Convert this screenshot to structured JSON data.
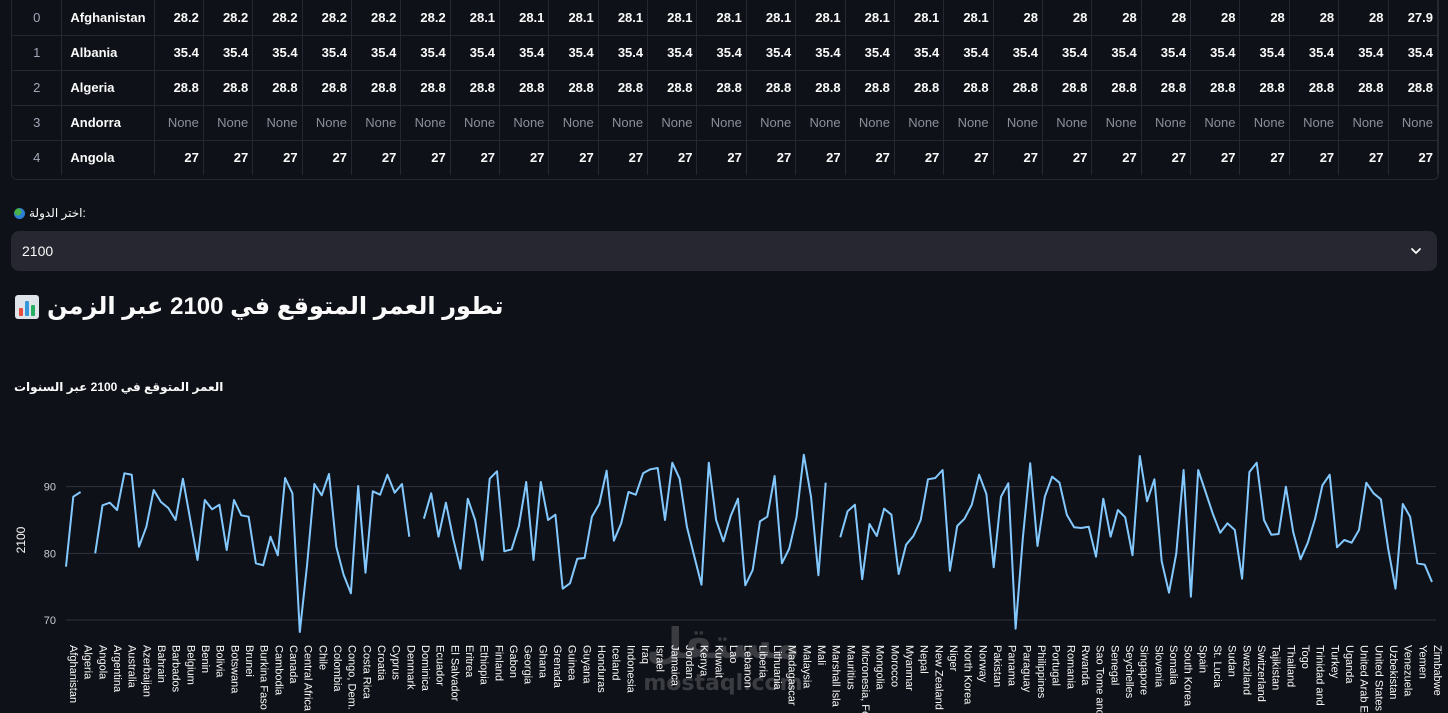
{
  "table": {
    "rows": [
      {
        "index": "0",
        "country": "Afghanistan",
        "values": [
          "28.2",
          "28.2",
          "28.2",
          "28.2",
          "28.2",
          "28.2",
          "28.1",
          "28.1",
          "28.1",
          "28.1",
          "28.1",
          "28.1",
          "28.1",
          "28.1",
          "28.1",
          "28.1",
          "28.1",
          "28",
          "28",
          "28",
          "28",
          "28",
          "28",
          "28",
          "28",
          "27.9"
        ]
      },
      {
        "index": "1",
        "country": "Albania",
        "values": [
          "35.4",
          "35.4",
          "35.4",
          "35.4",
          "35.4",
          "35.4",
          "35.4",
          "35.4",
          "35.4",
          "35.4",
          "35.4",
          "35.4",
          "35.4",
          "35.4",
          "35.4",
          "35.4",
          "35.4",
          "35.4",
          "35.4",
          "35.4",
          "35.4",
          "35.4",
          "35.4",
          "35.4",
          "35.4",
          "35.4"
        ]
      },
      {
        "index": "2",
        "country": "Algeria",
        "values": [
          "28.8",
          "28.8",
          "28.8",
          "28.8",
          "28.8",
          "28.8",
          "28.8",
          "28.8",
          "28.8",
          "28.8",
          "28.8",
          "28.8",
          "28.8",
          "28.8",
          "28.8",
          "28.8",
          "28.8",
          "28.8",
          "28.8",
          "28.8",
          "28.8",
          "28.8",
          "28.8",
          "28.8",
          "28.8",
          "28.8"
        ]
      },
      {
        "index": "3",
        "country": "Andorra",
        "values": [
          "None",
          "None",
          "None",
          "None",
          "None",
          "None",
          "None",
          "None",
          "None",
          "None",
          "None",
          "None",
          "None",
          "None",
          "None",
          "None",
          "None",
          "None",
          "None",
          "None",
          "None",
          "None",
          "None",
          "None",
          "None",
          "None"
        ]
      },
      {
        "index": "4",
        "country": "Angola",
        "values": [
          "27",
          "27",
          "27",
          "27",
          "27",
          "27",
          "27",
          "27",
          "27",
          "27",
          "27",
          "27",
          "27",
          "27",
          "27",
          "27",
          "27",
          "27",
          "27",
          "27",
          "27",
          "27",
          "27",
          "27",
          "27",
          "27"
        ]
      }
    ]
  },
  "select": {
    "label": "اختر الدولة:",
    "value": "2100"
  },
  "heading": {
    "text": "تطور العمر المتوقع في 2100 عبر الزمن"
  },
  "chart_title": "العمر المتوقع في 2100 عبر السنوات",
  "watermark": {
    "arabic": "مستقل",
    "latin": "mostaql.com"
  },
  "colors": {
    "background": "#0e1117",
    "line": "#83c9ff",
    "panel": "#262730"
  },
  "chart_data": {
    "type": "line",
    "ylabel": "2100",
    "ylim": [
      67,
      97
    ],
    "yticks": [
      70,
      80,
      90
    ],
    "grid": true,
    "categories": [
      "Afghanistan",
      "Algeria",
      "Angola",
      "Argentina",
      "Australia",
      "Azerbaijan",
      "Bahrain",
      "Barbados",
      "Belgium",
      "Benin",
      "Bolivia",
      "Botswana",
      "Brunei",
      "Burkina Faso",
      "Cambodia",
      "Canada",
      "Central Africa",
      "Chile",
      "Colombia",
      "Congo, Dem.",
      "Costa Rica",
      "Croatia",
      "Cyprus",
      "Denmark",
      "Dominica",
      "Ecuador",
      "El Salvador",
      "Eritrea",
      "Ethiopia",
      "Finland",
      "Gabon",
      "Georgia",
      "Ghana",
      "Grenada",
      "Guinea",
      "Guyana",
      "Honduras",
      "Iceland",
      "Indonesia",
      "Iraq",
      "Israel",
      "Jamaica",
      "Jordan",
      "Kenya",
      "Kuwait",
      "Lao",
      "Lebanon",
      "Liberia",
      "Lithuania",
      "Madagascar",
      "Malaysia",
      "Mali",
      "Marshall Isla",
      "Mauritius",
      "Micronesia, Fe",
      "Mongolia",
      "Morocco",
      "Myanmar",
      "Nepal",
      "New Zealand",
      "Niger",
      "North Korea",
      "Norway",
      "Pakistan",
      "Panama",
      "Paraguay",
      "Philippines",
      "Portugal",
      "Romania",
      "Rwanda",
      "Sao Tome and",
      "Senegal",
      "Seychelles",
      "Singapore",
      "Slovenia",
      "Somalia",
      "South Korea",
      "Spain",
      "St. Lucia",
      "Sudan",
      "Swaziland",
      "Switzerland",
      "Tajikistan",
      "Thailand",
      "Togo",
      "Trinidad and",
      "Turkey",
      "Uganda",
      "United Arab E",
      "United States",
      "Uzbekistan",
      "Venezuela",
      "Yemen",
      "Zimbabwe"
    ],
    "series": [
      {
        "values": [
          78,
          88.5,
          89.2,
          null,
          80,
          87.2,
          87.6,
          86.5,
          92,
          91.8,
          81,
          84,
          89.5,
          87.7,
          86.8,
          85,
          91.2,
          85.1,
          79,
          88,
          86.6,
          87.3,
          80.5,
          88,
          85.7,
          85.5,
          78.5,
          78.2,
          82.5,
          79.7,
          91.3,
          89,
          68.2,
          78.3,
          90.4,
          88.7,
          91.9,
          81,
          76.8,
          74,
          90.1,
          77.1,
          89.3,
          88.8,
          91.8,
          89.1,
          90.4,
          82.5,
          null,
          85.2,
          89,
          82.5,
          87.6,
          82.2,
          77.7,
          88.2,
          85,
          79,
          91.2,
          92.3,
          80.3,
          80.6,
          84.1,
          90.7,
          79,
          90.7,
          85,
          85.8,
          74.7,
          75.5,
          79.2,
          79.3,
          85.5,
          87.4,
          92.4,
          81.9,
          84.5,
          89.2,
          88.8,
          92,
          92.6,
          92.8,
          85,
          93.6,
          91.2,
          84,
          79.6,
          75.3,
          93.6,
          85,
          81.8,
          85.6,
          88.2,
          75.2,
          77.5,
          84.8,
          85.5,
          91.6,
          78.5,
          80.7,
          85.4,
          94.8,
          88.4,
          76.7,
          90.6,
          null,
          82.4,
          86.3,
          87.3,
          76.1,
          84.4,
          82.6,
          86.7,
          85.8,
          76.9,
          81.3,
          82.6,
          85,
          91.1,
          91.3,
          92.5,
          77.4,
          84.1,
          85.2,
          87.3,
          91.8,
          88.9,
          77.9,
          88.5,
          90.5,
          68.7,
          82.4,
          93.5,
          81.1,
          88.5,
          91.5,
          90.6,
          85.8,
          83.9,
          83.8,
          84,
          79.5,
          88.2,
          82.5,
          86.5,
          85.4,
          79.7,
          94.6,
          87.8,
          91.1,
          78.8,
          74.1,
          80,
          92.5,
          73.5,
          92.5,
          89.2,
          85.9,
          83.1,
          84.5,
          83.5,
          76.2,
          92.2,
          93.6,
          85,
          82.8,
          82.9,
          90,
          83.2,
          79.1,
          81.6,
          85.2,
          90.2,
          91.8,
          80.9,
          82,
          81.6,
          83.5,
          90.6,
          89,
          88.1,
          80.7,
          74.7,
          87.4,
          85.5,
          78.5,
          78.3,
          75.7
        ]
      }
    ]
  }
}
